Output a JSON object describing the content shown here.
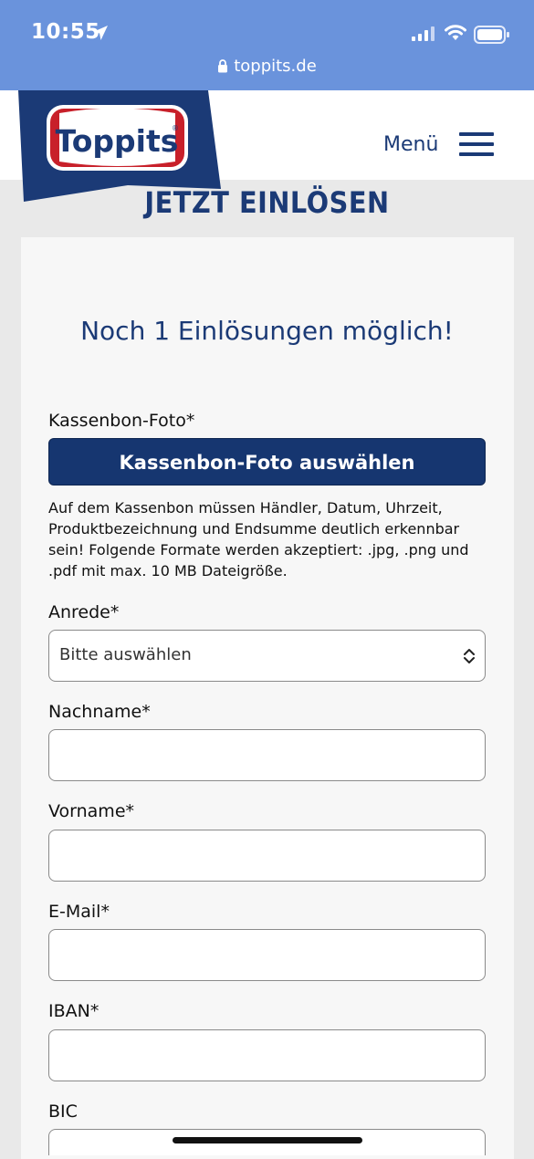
{
  "status": {
    "time": "10:55",
    "url": "toppits.de"
  },
  "header": {
    "logo_text": "Toppits",
    "menu_label": "Menü"
  },
  "page": {
    "heading": "JETZT EINLÖSEN",
    "remaining_text": "Noch 1 Einlösungen möglich!"
  },
  "form": {
    "receipt_label": "Kassenbon-Foto*",
    "receipt_button": "Kassenbon-Foto auswählen",
    "receipt_hint": "Auf dem Kassenbon müssen Händler, Datum, Uhrzeit, Produktbezeichnung und Endsumme deutlich erkennbar sein! Folgende Formate werden akzeptiert: .jpg, .png und .pdf mit max. 10 MB Dateigröße.",
    "salutation_label": "Anrede*",
    "salutation_value": "Bitte auswählen",
    "lastname_label": "Nachname*",
    "firstname_label": "Vorname*",
    "email_label": "E-Mail*",
    "iban_label": "IBAN*",
    "bic_label": "BIC"
  },
  "colors": {
    "status_bar": "#6a93dc",
    "brand_blue": "#1b3a76",
    "button_blue": "#163670",
    "logo_red": "#c8202a"
  }
}
